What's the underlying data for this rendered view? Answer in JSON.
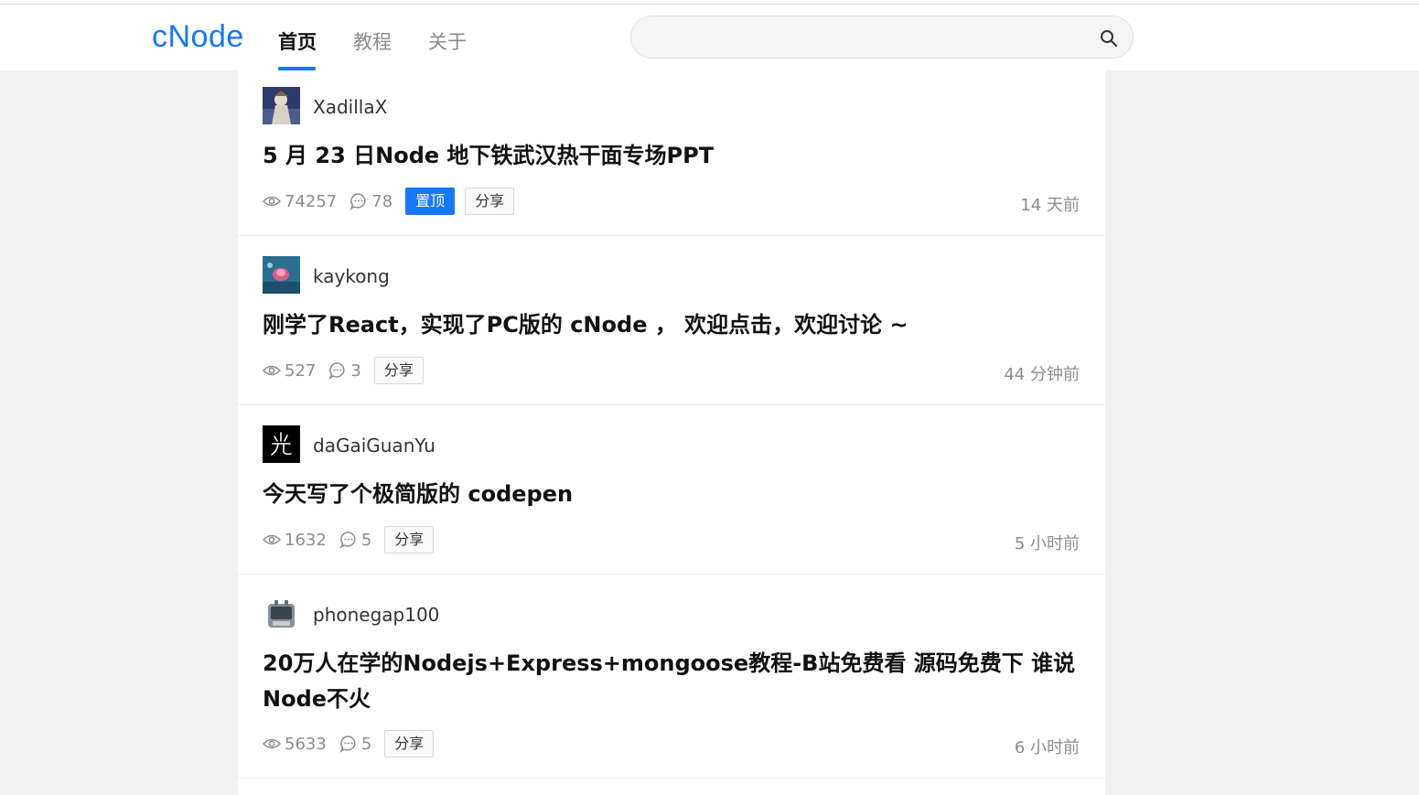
{
  "header": {
    "logo": "cNode",
    "nav": [
      {
        "label": "首页",
        "active": true
      },
      {
        "label": "教程",
        "active": false
      },
      {
        "label": "关于",
        "active": false
      }
    ],
    "search": {
      "placeholder": "",
      "value": "",
      "icon": "search-icon"
    }
  },
  "topics": [
    {
      "author": "XadillaX",
      "title": "5 月 23 日Node 地下铁武汉热干面专场PPT",
      "views": "74257",
      "replies": "78",
      "tags": [
        "置顶",
        "分享"
      ],
      "time": "14 天前"
    },
    {
      "author": "kaykong",
      "title": "刚学了React，实现了PC版的 cNode ， 欢迎点击，欢迎讨论 ~",
      "views": "527",
      "replies": "3",
      "tags": [
        "分享"
      ],
      "time": "44 分钟前"
    },
    {
      "author": "daGaiGuanYu",
      "title": "今天写了个极简版的 codepen",
      "views": "1632",
      "replies": "5",
      "tags": [
        "分享"
      ],
      "time": "5 小时前"
    },
    {
      "author": "phonegap100",
      "title": "20万人在学的Nodejs+Express+mongoose教程-B站免费看 源码免费下 谁说Node不火",
      "views": "5633",
      "replies": "5",
      "tags": [
        "分享"
      ],
      "time": "6 小时前"
    }
  ],
  "colors": {
    "accent": "#1677ff",
    "background": "#f0f0f0",
    "muted": "#8c8c8c"
  }
}
